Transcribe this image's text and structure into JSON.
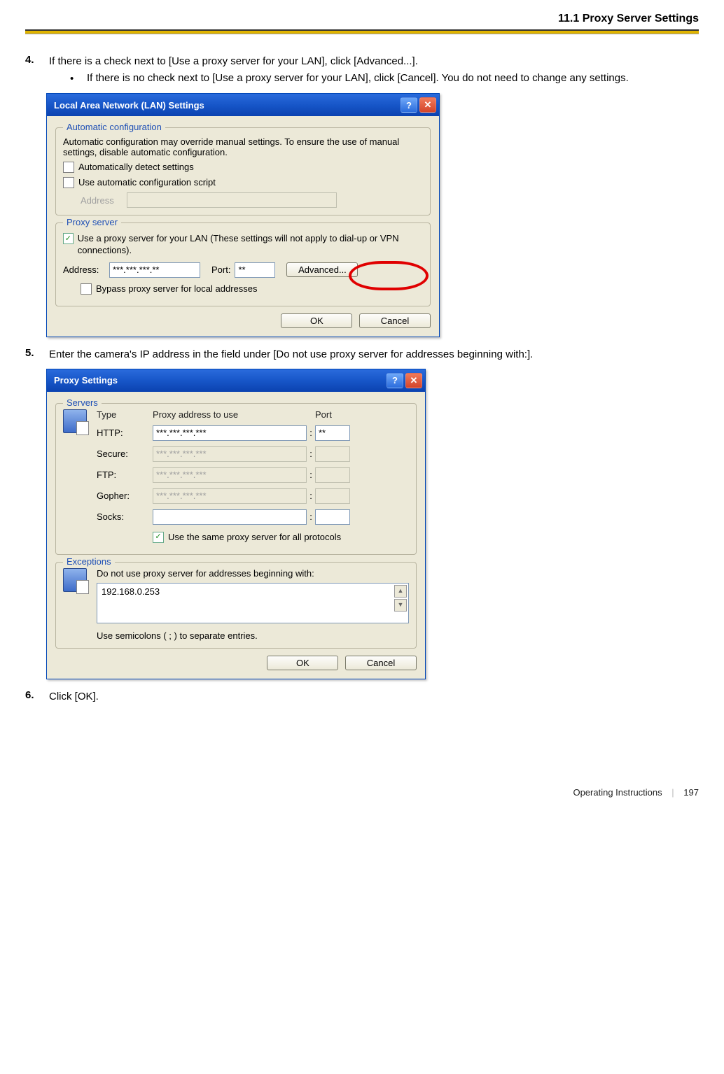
{
  "header": {
    "section_title": "11.1 Proxy Server Settings"
  },
  "steps": {
    "s4": {
      "num": "4.",
      "text": "If there is a check next to [Use a proxy server for your LAN], click [Advanced...].",
      "bullet": "If there is no check next to [Use a proxy server for your LAN], click [Cancel]. You do not need to change any settings."
    },
    "s5": {
      "num": "5.",
      "text": "Enter the camera's IP address in the field under [Do not use proxy server for addresses beginning with:]."
    },
    "s6": {
      "num": "6.",
      "text": "Click [OK]."
    }
  },
  "lan_dialog": {
    "title": "Local Area Network (LAN) Settings",
    "help_glyph": "?",
    "close_glyph": "✕",
    "auto_legend": "Automatic configuration",
    "auto_desc": "Automatic configuration may override manual settings.  To ensure the use of manual settings, disable automatic configuration.",
    "chk_detect": "Automatically detect settings",
    "chk_script": "Use automatic configuration script",
    "addr_label": "Address",
    "proxy_legend": "Proxy server",
    "chk_useproxy": "Use a proxy server for your LAN (These settings will not apply to dial-up or VPN connections).",
    "addr2_label": "Address:",
    "addr2_val": "***.***.***.**",
    "port_label": "Port:",
    "port_val": "**",
    "advanced_btn": "Advanced...",
    "chk_bypass": "Bypass proxy server for local addresses",
    "ok_btn": "OK",
    "cancel_btn": "Cancel"
  },
  "proxy_dialog": {
    "title": "Proxy Settings",
    "help_glyph": "?",
    "close_glyph": "✕",
    "servers_legend": "Servers",
    "hdr_type": "Type",
    "hdr_addr": "Proxy address to use",
    "hdr_port": "Port",
    "rows": {
      "http": {
        "label": "HTTP:",
        "addr": "***.***.***.***",
        "port": "**",
        "enabled": true
      },
      "secure": {
        "label": "Secure:",
        "addr": "***.***.***.***",
        "port": "",
        "enabled": false
      },
      "ftp": {
        "label": "FTP:",
        "addr": "***.***.***.***",
        "port": "",
        "enabled": false
      },
      "gopher": {
        "label": "Gopher:",
        "addr": "***.***.***.***",
        "port": "",
        "enabled": false
      },
      "socks": {
        "label": "Socks:",
        "addr": "",
        "port": "",
        "enabled": true
      }
    },
    "chk_same": "Use the same proxy server for all protocols",
    "exc_legend": "Exceptions",
    "exc_label": "Do not use proxy server for addresses beginning with:",
    "exc_value": "192.168.0.253",
    "exc_hint": "Use semicolons ( ; ) to separate entries.",
    "ok_btn": "OK",
    "cancel_btn": "Cancel"
  },
  "footer": {
    "doc": "Operating Instructions",
    "page": "197"
  }
}
